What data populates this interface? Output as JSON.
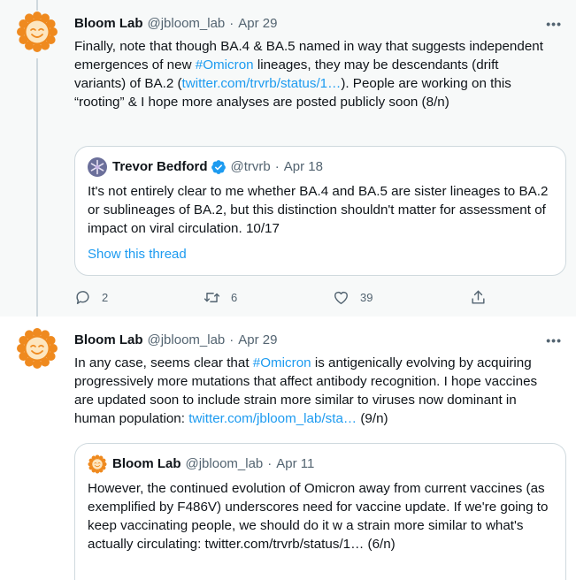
{
  "tweets": [
    {
      "name": "Bloom Lab",
      "handle": "@jbloom_lab",
      "date": "Apr 29",
      "more": "•••",
      "text": {
        "p1": "Finally, note that though BA.4 & BA.5 named in way that suggests independent emergences of new ",
        "hashtag": "#Omicron",
        "p2": " lineages, they may be descendants (drift variants) of BA.2 (",
        "link": "twitter.com/trvrb/status/1…",
        "p3": "). People are working on this “rooting” & I hope more analyses are posted publicly soon (8/n)"
      },
      "quote": {
        "name": "Trevor Bedford",
        "handle": "@trvrb",
        "date": "Apr 18",
        "verified": true,
        "avatar_icon": "snowflake-avatar-icon",
        "text": "It's not entirely clear to me whether BA.4 and BA.5 are sister lineages to BA.2 or sublineages of BA.2, but this distinction shouldn't matter for assessment of impact on viral circulation. 10/17",
        "show_thread": "Show this thread"
      },
      "actions": {
        "replies": "2",
        "retweets": "6",
        "likes": "39"
      }
    },
    {
      "name": "Bloom Lab",
      "handle": "@jbloom_lab",
      "date": "Apr 29",
      "more": "•••",
      "text": {
        "p1": "In any case, seems clear that ",
        "hashtag": "#Omicron",
        "p2": " is antigenically evolving by acquiring progressively more mutations that affect antibody recognition. I hope vaccines are updated soon to include strain more similar to viruses now dominant in human population: ",
        "link": "twitter.com/jbloom_lab/sta…",
        "p3": " (9/n)"
      },
      "quote": {
        "name": "Bloom Lab",
        "handle": "@jbloom_lab",
        "date": "Apr 11",
        "avatar_icon": "sun-avatar-icon",
        "text": "However, the continued evolution of Omicron away from current vaccines (as exemplified by F486V) underscores need for vaccine update. If we're going to keep vaccinating people, we should do it w a strain more similar to what's actually circulating: twitter.com/trvrb/status/1… (6/n)"
      }
    }
  ],
  "colors": {
    "accent": "#1d9bf0",
    "muted": "#536471",
    "text": "#0f1419",
    "border": "#cfd9de",
    "highlight_bg": "#f7f9f9",
    "sun_orange": "#ef8a1f",
    "sun_face": "#fde6bf"
  }
}
